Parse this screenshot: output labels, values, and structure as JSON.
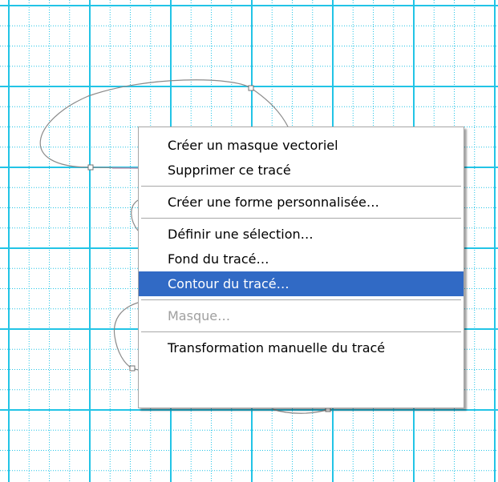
{
  "colors": {
    "grid_major": "#22c4e6",
    "grid_minor": "#22c4e6",
    "path_stroke": "#8a8a8a",
    "menu_highlight": "#316ac5"
  },
  "context_menu": {
    "items": [
      {
        "label": "Créer un masque vectoriel",
        "state": "normal"
      },
      {
        "label": "Supprimer ce tracé",
        "state": "normal"
      },
      {
        "label": "Créer une forme personnalisée…",
        "state": "normal"
      },
      {
        "label": "Définir une sélection…",
        "state": "normal"
      },
      {
        "label": "Fond du tracé…",
        "state": "normal"
      },
      {
        "label": "Contour du tracé…",
        "state": "highlighted"
      },
      {
        "label": "Masque…",
        "state": "disabled"
      },
      {
        "label": "Transformation manuelle du tracé",
        "state": "normal"
      }
    ]
  }
}
